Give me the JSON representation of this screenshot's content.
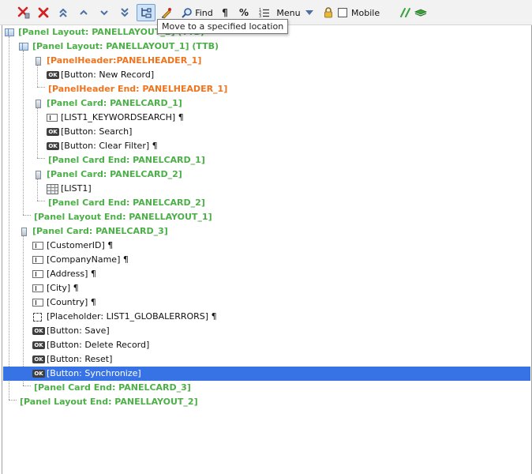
{
  "toolbar": {
    "find_label": "Find",
    "pilcrow": "¶",
    "percent": "%",
    "menu_label": "Menu",
    "mobile_label": "Mobile",
    "mobile_checked": false,
    "icons": [
      "delete-selected-icon",
      "delete-icon",
      "move-top-icon",
      "move-up-icon",
      "move-down-icon",
      "move-bottom-icon",
      "move-to-location-icon",
      "edit-icon",
      "find-icon",
      "pilcrow-icon",
      "percent-icon",
      "numbered-list-icon",
      "menu-dropdown-icon",
      "lock-icon",
      "code-icon",
      "stack-icon"
    ]
  },
  "tooltip": {
    "text": "Move to a specified location"
  },
  "tree": {
    "rows": [
      {
        "label": "[Panel Layout: PANELLAYOUT_2] (TTB)",
        "style": "green",
        "icon": "panel-layout-icon"
      },
      {
        "label": "[Panel Layout: PANELLAYOUT_1] (TTB)",
        "style": "green",
        "icon": "panel-layout-icon"
      },
      {
        "label": "[PanelHeader:PANELHEADER_1]",
        "style": "orange",
        "icon": "panel-header-icon"
      },
      {
        "label": "[Button: New Record]",
        "style": "normal",
        "icon": "button-icon"
      },
      {
        "label": "[PanelHeader End: PANELHEADER_1]",
        "style": "orange",
        "icon": ""
      },
      {
        "label": "[Panel Card: PANELCARD_1]",
        "style": "green",
        "icon": "panel-card-icon"
      },
      {
        "label": "[LIST1_KEYWORDSEARCH] ¶",
        "style": "normal",
        "icon": "text-field-icon"
      },
      {
        "label": "[Button: Search]",
        "style": "normal",
        "icon": "button-icon"
      },
      {
        "label": "[Button: Clear Filter] ¶",
        "style": "normal",
        "icon": "button-icon"
      },
      {
        "label": "[Panel Card End: PANELCARD_1]",
        "style": "green",
        "icon": ""
      },
      {
        "label": "[Panel Card: PANELCARD_2]",
        "style": "green",
        "icon": "panel-card-icon"
      },
      {
        "label": "[LIST1]",
        "style": "normal",
        "icon": "grid-icon"
      },
      {
        "label": "[Panel Card End: PANELCARD_2]",
        "style": "green",
        "icon": ""
      },
      {
        "label": "[Panel Layout End: PANELLAYOUT_1]",
        "style": "green",
        "icon": ""
      },
      {
        "label": "[Panel Card: PANELCARD_3]",
        "style": "green",
        "icon": "panel-card-icon"
      },
      {
        "label": "[CustomerID] ¶",
        "style": "normal",
        "icon": "text-field-icon"
      },
      {
        "label": "[CompanyName] ¶",
        "style": "normal",
        "icon": "text-field-icon"
      },
      {
        "label": "[Address] ¶",
        "style": "normal",
        "icon": "text-field-icon"
      },
      {
        "label": "[City] ¶",
        "style": "normal",
        "icon": "text-field-icon"
      },
      {
        "label": "[Country] ¶",
        "style": "normal",
        "icon": "text-field-icon"
      },
      {
        "label": "[Placeholder: LIST1_GLOBALERRORS] ¶",
        "style": "normal",
        "icon": "placeholder-icon"
      },
      {
        "label": "[Button: Save]",
        "style": "normal",
        "icon": "button-icon"
      },
      {
        "label": "[Button: Delete Record]",
        "style": "normal",
        "icon": "button-icon"
      },
      {
        "label": "[Button: Reset]",
        "style": "normal",
        "icon": "button-icon"
      },
      {
        "label": "[Button: Synchronize]",
        "style": "normal",
        "icon": "button-icon",
        "selected": true
      },
      {
        "label": "[Panel Card End: PANELCARD_3]",
        "style": "green",
        "icon": ""
      },
      {
        "label": "[Panel Layout End: PANELLAYOUT_2]",
        "style": "green",
        "icon": ""
      }
    ]
  },
  "colors": {
    "green_label": "#4caf48",
    "orange_label": "#f0731e",
    "selection": "#3873e6",
    "tooltip_border": "#767676"
  }
}
